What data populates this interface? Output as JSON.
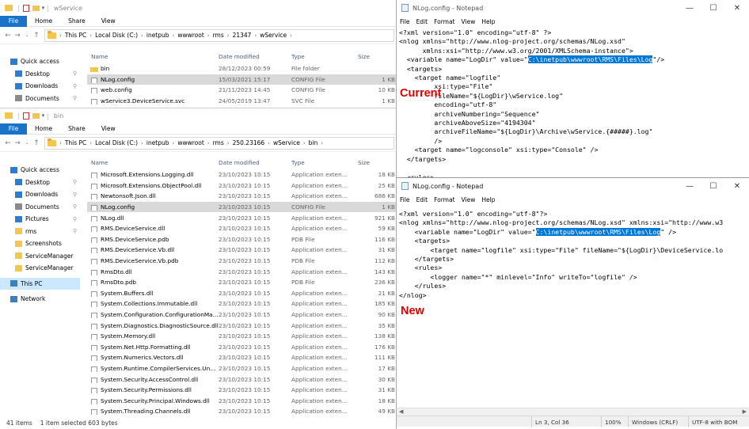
{
  "explorer_top": {
    "title": "wService",
    "ribbon": [
      "File",
      "Home",
      "Share",
      "View"
    ],
    "path": [
      "This PC",
      "Local Disk (C:)",
      "inetpub",
      "wwwroot",
      "rms",
      "21347",
      "wService"
    ],
    "columns": {
      "name": "Name",
      "date": "Date modified",
      "type": "Type",
      "size": "Size"
    },
    "rows": [
      {
        "name": "bin",
        "date": "28/12/2023 00:59",
        "type": "File folder",
        "size": "",
        "folder": true
      },
      {
        "name": "NLog.config",
        "date": "15/03/2021 15:17",
        "type": "CONFIG File",
        "size": "1 KB",
        "selected": true
      },
      {
        "name": "web.config",
        "date": "21/11/2023 14:45",
        "type": "CONFIG File",
        "size": "10 KB"
      },
      {
        "name": "wService3.DeviceService.svc",
        "date": "24/05/2019 13:47",
        "type": "SVC File",
        "size": "1 KB"
      }
    ],
    "sidebar": [
      "Quick access",
      "Desktop",
      "Downloads",
      "Documents"
    ]
  },
  "explorer_bottom": {
    "title": "bin",
    "ribbon": [
      "File",
      "Home",
      "Share",
      "View"
    ],
    "path": [
      "This PC",
      "Local Disk (C:)",
      "inetpub",
      "wwwroot",
      "rms",
      "250.23166",
      "wService",
      "bin"
    ],
    "columns": {
      "name": "Name",
      "date": "Date modified",
      "type": "Type",
      "size": "Size"
    },
    "rows": [
      {
        "name": "Microsoft.Extensions.Logging.dll",
        "date": "23/10/2023 10:15",
        "type": "Application exten...",
        "size": "18 KB"
      },
      {
        "name": "Microsoft.Extensions.ObjectPool.dll",
        "date": "23/10/2023 10:15",
        "type": "Application exten...",
        "size": "25 KB"
      },
      {
        "name": "Newtonsoft.Json.dll",
        "date": "23/10/2023 10:15",
        "type": "Application exten...",
        "size": "686 KB"
      },
      {
        "name": "NLog.config",
        "date": "23/10/2023 10:15",
        "type": "CONFIG File",
        "size": "1 KB",
        "selected": true
      },
      {
        "name": "NLog.dll",
        "date": "23/10/2023 10:15",
        "type": "Application exten...",
        "size": "921 KB"
      },
      {
        "name": "RMS.DeviceService.dll",
        "date": "23/10/2023 10:15",
        "type": "Application exten...",
        "size": "59 KB"
      },
      {
        "name": "RMS.DeviceService.pdb",
        "date": "23/10/2023 10:15",
        "type": "PDB File",
        "size": "116 KB"
      },
      {
        "name": "RMS.DeviceService.Vb.dll",
        "date": "23/10/2023 10:15",
        "type": "Application exten...",
        "size": "31 KB"
      },
      {
        "name": "RMS.DeviceService.Vb.pdb",
        "date": "23/10/2023 10:15",
        "type": "PDB File",
        "size": "112 KB"
      },
      {
        "name": "RmsDto.dll",
        "date": "23/10/2023 10:15",
        "type": "Application exten...",
        "size": "143 KB"
      },
      {
        "name": "RmsDto.pdb",
        "date": "23/10/2023 10:15",
        "type": "PDB File",
        "size": "236 KB"
      },
      {
        "name": "System.Buffers.dll",
        "date": "23/10/2023 10:15",
        "type": "Application exten...",
        "size": "21 KB"
      },
      {
        "name": "System.Collections.Immutable.dll",
        "date": "23/10/2023 10:15",
        "type": "Application exten...",
        "size": "185 KB"
      },
      {
        "name": "System.Configuration.ConfigurationMan...",
        "date": "23/10/2023 10:15",
        "type": "Application exten...",
        "size": "90 KB"
      },
      {
        "name": "System.Diagnostics.DiagnosticSource.dll",
        "date": "23/10/2023 10:15",
        "type": "Application exten...",
        "size": "35 KB"
      },
      {
        "name": "System.Memory.dll",
        "date": "23/10/2023 10:15",
        "type": "Application exten...",
        "size": "138 KB"
      },
      {
        "name": "System.Net.Http.Formatting.dll",
        "date": "23/10/2023 10:15",
        "type": "Application exten...",
        "size": "176 KB"
      },
      {
        "name": "System.Numerics.Vectors.dll",
        "date": "23/10/2023 10:15",
        "type": "Application exten...",
        "size": "111 KB"
      },
      {
        "name": "System.Runtime.CompilerServices.Unsaf...",
        "date": "23/10/2023 10:15",
        "type": "Application exten...",
        "size": "17 KB"
      },
      {
        "name": "System.Security.AccessControl.dll",
        "date": "23/10/2023 10:15",
        "type": "Application exten...",
        "size": "30 KB"
      },
      {
        "name": "System.Security.Permissions.dll",
        "date": "23/10/2023 10:15",
        "type": "Application exten...",
        "size": "31 KB"
      },
      {
        "name": "System.Security.Principal.Windows.dll",
        "date": "23/10/2023 10:15",
        "type": "Application exten...",
        "size": "18 KB"
      },
      {
        "name": "System.Threading.Channels.dll",
        "date": "23/10/2023 10:15",
        "type": "Application exten...",
        "size": "49 KB"
      }
    ],
    "sidebar": [
      {
        "label": "Quick access",
        "icon": "star-icon"
      },
      {
        "label": "Desktop",
        "icon": "desktop-icon",
        "pin": true
      },
      {
        "label": "Downloads",
        "icon": "download-icon",
        "pin": true
      },
      {
        "label": "Documents",
        "icon": "documents-icon",
        "pin": true
      },
      {
        "label": "Pictures",
        "icon": "pictures-icon",
        "pin": true
      },
      {
        "label": "rms",
        "icon": "folder-icon",
        "pin": true
      },
      {
        "label": "Screenshots",
        "icon": "folder-icon"
      },
      {
        "label": "ServiceManager",
        "icon": "folder-icon"
      },
      {
        "label": "ServiceManager",
        "icon": "folder-icon"
      },
      {
        "label": "This PC",
        "icon": "computer-icon",
        "selected": true
      },
      {
        "label": "Network",
        "icon": "network-icon"
      }
    ],
    "status": {
      "items": "41 items",
      "selected": "1 item selected  603 bytes"
    }
  },
  "notepad_top": {
    "title": "NLog.config - Notepad",
    "menu": [
      "File",
      "Edit",
      "Format",
      "View",
      "Help"
    ],
    "lines": [
      "<?xml version=\"1.0\" encoding=\"utf-8\" ?>",
      "<nlog xmlns=\"http://www.nlog-project.org/schemas/NLog.xsd\"",
      "      xmlns:xsi=\"http://www.w3.org/2001/XMLSchema-instance\">",
      "  <variable name=\"LogDir\" value=\"|C:\\inetpub\\wwwroot\\RMS\\Files\\Log|\"/>",
      "  <targets>",
      "    <target name=\"logfile\"",
      "         xsi:type=\"File\"",
      "         fileName=\"${LogDir}\\wService.log\"",
      "         encoding=\"utf-8\"",
      "         archiveNumbering=\"Sequence\"",
      "         archiveAboveSize=\"4194304\"",
      "         archiveFileName=\"${LogDir}\\Archive\\wService.{#####}.log\"",
      "         />",
      "    <target name=\"logconsole\" xsi:type=\"Console\" />",
      "  </targets>",
      "",
      "  <rules>"
    ],
    "label": "Current"
  },
  "notepad_bottom": {
    "title": "NLog.config - Notepad",
    "menu": [
      "File",
      "Edit",
      "Format",
      "View",
      "Help"
    ],
    "lines": [
      "<?xml version=\"1.0\" encoding=\"utf-8\"?>",
      "<nlog xmlns=\"http://www.nlog-project.org/schemas/NLog.xsd\" xmlns:xsi=\"http://www.w3",
      "    <variable name=\"LogDir\" value=\"|C:\\inetpub\\wwwroot\\RMS\\Files\\Log|\" />",
      "    <targets>",
      "        <target name=\"logfile\" xsi:type=\"File\" fileName=\"${LogDir}\\DeviceService.lo",
      "    </targets>",
      "    <rules>",
      "        <logger name=\"*\" minlevel=\"Info\" writeTo=\"logfile\" />",
      "    </rules>",
      "</nlog>"
    ],
    "label": "New",
    "status": {
      "position": "Ln 3, Col 36",
      "zoom": "100%",
      "eol": "Windows (CRLF)",
      "encoding": "UTF-8 with BOM"
    }
  }
}
